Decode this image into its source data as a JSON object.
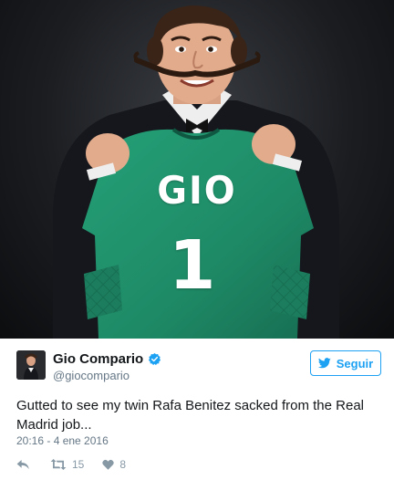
{
  "media": {
    "jersey_name": "GIO",
    "jersey_number": "1",
    "colors": {
      "background": "#1b1d21",
      "jersey": "#1e8a66",
      "suit": "#15171c"
    }
  },
  "tweet": {
    "display_name": "Gio Compario",
    "handle": "@giocompario",
    "follow_label": "Seguir",
    "text": "Gutted to see my twin Rafa Benitez sacked from the Real Madrid job...",
    "timestamp": "20:16 - 4 ene 2016",
    "retweets": "15",
    "likes": "8",
    "icons": [
      "verified-icon",
      "twitter-bird-icon",
      "reply-icon",
      "retweet-icon",
      "heart-icon"
    ],
    "colors": {
      "accent": "#1da1f2",
      "secondary_text": "#657786",
      "action_icons": "#8899a6"
    }
  }
}
